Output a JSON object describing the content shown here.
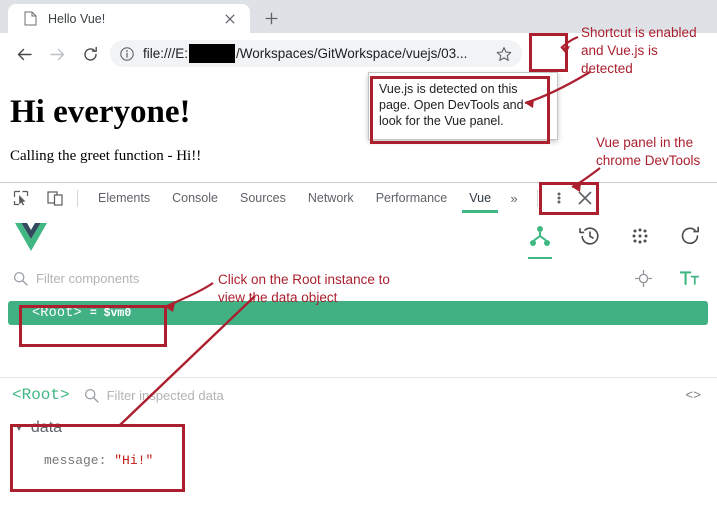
{
  "browser": {
    "tab": {
      "title": "Hello Vue!",
      "favicon_icon": "page-icon",
      "close_icon": "close-icon"
    },
    "new_tab_label": "+",
    "nav": {
      "back_icon": "arrow-left-icon",
      "forward_icon": "arrow-right-icon",
      "reload_icon": "reload-icon"
    },
    "omnibox": {
      "info_icon": "info-circle-icon",
      "url_prefix": "file:///E:",
      "url_suffix": "/Workspaces/GitWorkspace/vuejs/03...",
      "star_icon": "star-icon"
    },
    "extension": {
      "icon_name": "vue-extension-icon",
      "tooltip": "Vue.js is detected on this page. Open DevTools and look for the Vue panel."
    }
  },
  "page": {
    "heading": "Hi everyone!",
    "paragraph": "Calling the greet function - Hi!!"
  },
  "devtools": {
    "inspect_icon": "inspect-element-icon",
    "device_toggle_icon": "device-toolbar-icon",
    "tabs": [
      {
        "label": "Elements",
        "active": false
      },
      {
        "label": "Console",
        "active": false
      },
      {
        "label": "Sources",
        "active": false
      },
      {
        "label": "Network",
        "active": false
      },
      {
        "label": "Performance",
        "active": false
      },
      {
        "label": "Vue",
        "active": true
      }
    ],
    "more_tabs_label": "»",
    "menu_icon": "kebab-menu-icon",
    "close_icon": "close-icon",
    "vue_panel": {
      "logo_icon": "vue-logo-icon",
      "tools": [
        {
          "name": "component-tree-icon",
          "active": true
        },
        {
          "name": "time-travel-icon",
          "active": false
        },
        {
          "name": "events-icon",
          "active": false
        },
        {
          "name": "refresh-icon",
          "active": false
        }
      ],
      "component_filter": {
        "search_icon": "search-icon",
        "placeholder": "Filter components",
        "value": "",
        "select_target_icon": "target-select-icon",
        "text_size_icon": "text-size-icon"
      },
      "tree": {
        "root_label": "<Root>",
        "root_eq": "=",
        "root_vm": "$vm0"
      },
      "inspector": {
        "root_label": "<Root>",
        "search_icon": "search-icon",
        "placeholder": "Filter inspected data",
        "value": "",
        "code_toggle_label": "<>",
        "data_group": {
          "caret": "▼",
          "name": "data",
          "entries": [
            {
              "key": "message:",
              "value": "\"Hi!\""
            }
          ]
        }
      }
    }
  },
  "annotations": [
    {
      "id": "anno-shortcut",
      "text": "Shortcut is enabled\nand Vue.js is\ndetected"
    },
    {
      "id": "anno-vue-panel",
      "text": "Vue panel in the\nchrome DevTools"
    },
    {
      "id": "anno-root-click",
      "text": "Click on the Root instance to\nview the data object"
    }
  ],
  "colors": {
    "vue_green": "#41b883",
    "annotation_red": "#ab1f2e",
    "chrome_tabstrip": "#dee1e6"
  }
}
